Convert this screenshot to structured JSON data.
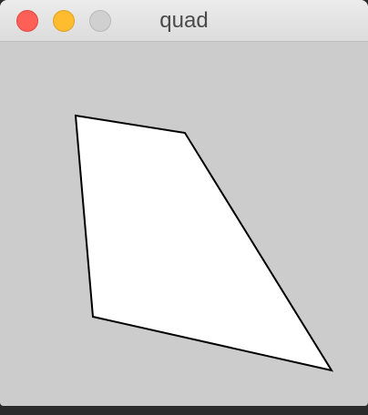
{
  "window": {
    "title": "quad",
    "controls": {
      "close_color": "#fe5f57",
      "minimize_color": "#febc2e",
      "zoom_color": "#d0d0d0"
    }
  },
  "sketch": {
    "background": "#cccccc",
    "shape": {
      "type": "quad",
      "fill": "#ffffff",
      "stroke": "#000000"
    }
  }
}
